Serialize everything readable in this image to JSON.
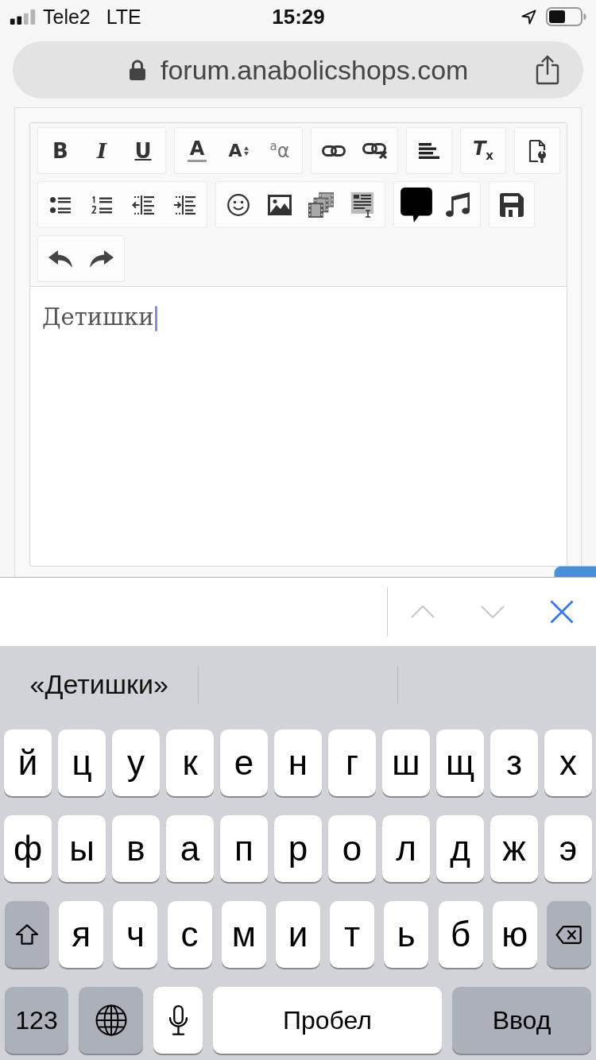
{
  "status_bar": {
    "carrier": "Tele2",
    "network": "LTE",
    "time": "15:29"
  },
  "address_bar": {
    "url": "forum.anabolicshops.com"
  },
  "editor": {
    "toolbar": [
      {
        "buttons": [
          {
            "kind": "bold",
            "label": "B"
          },
          {
            "kind": "italic",
            "label": "I"
          },
          {
            "kind": "underline",
            "label": "U"
          }
        ]
      },
      {
        "buttons": [
          {
            "kind": "color",
            "label": "A"
          },
          {
            "kind": "size",
            "label": "A"
          },
          {
            "kind": "case",
            "label": "$^{a}$α"
          }
        ]
      },
      {
        "buttons": [
          {
            "kind": "link"
          },
          {
            "kind": "unlink"
          }
        ]
      },
      {
        "buttons": [
          {
            "kind": "align"
          }
        ]
      },
      {
        "buttons": [
          {
            "kind": "clear",
            "label": "T$_{x}$"
          }
        ]
      },
      {
        "buttons": [
          {
            "kind": "source"
          }
        ]
      },
      {
        "buttons": [
          {
            "kind": "bullets"
          },
          {
            "kind": "numbers"
          },
          {
            "kind": "outdent"
          },
          {
            "kind": "indent"
          }
        ]
      },
      {
        "buttons": [
          {
            "kind": "smiley"
          },
          {
            "kind": "image"
          },
          {
            "kind": "media"
          },
          {
            "kind": "template"
          }
        ]
      },
      {
        "buttons": [
          {
            "kind": "comment"
          },
          {
            "kind": "audio"
          }
        ]
      },
      {
        "buttons": [
          {
            "kind": "save"
          }
        ]
      },
      {
        "buttons": [
          {
            "kind": "undo"
          },
          {
            "kind": "redo"
          }
        ]
      }
    ],
    "text": "Детишки"
  },
  "accessory_bar": {
    "buttons": [
      {
        "kind": "previous",
        "disabled": true
      },
      {
        "kind": "next",
        "disabled": true
      },
      {
        "kind": "close",
        "disabled": false
      }
    ]
  },
  "keyboard": {
    "suggestions": [
      "«Детишки»"
    ],
    "rows": [
      {
        "keys": [
          {
            "kind": "letter",
            "label": "й"
          },
          {
            "kind": "letter",
            "label": "ц"
          },
          {
            "kind": "letter",
            "label": "у"
          },
          {
            "kind": "letter",
            "label": "к"
          },
          {
            "kind": "letter",
            "label": "е"
          },
          {
            "kind": "letter",
            "label": "н"
          },
          {
            "kind": "letter",
            "label": "г"
          },
          {
            "kind": "letter",
            "label": "ш"
          },
          {
            "kind": "letter",
            "label": "щ"
          },
          {
            "kind": "letter",
            "label": "з"
          },
          {
            "kind": "letter",
            "label": "х"
          }
        ]
      },
      {
        "keys": [
          {
            "kind": "letter",
            "label": "ф"
          },
          {
            "kind": "letter",
            "label": "ы"
          },
          {
            "kind": "letter",
            "label": "в"
          },
          {
            "kind": "letter",
            "label": "а"
          },
          {
            "kind": "letter",
            "label": "п"
          },
          {
            "kind": "letter",
            "label": "р"
          },
          {
            "kind": "letter",
            "label": "о"
          },
          {
            "kind": "letter",
            "label": "л"
          },
          {
            "kind": "letter",
            "label": "д"
          },
          {
            "kind": "letter",
            "label": "ж"
          },
          {
            "kind": "letter",
            "label": "э"
          }
        ]
      },
      {
        "keys": [
          {
            "kind": "shift"
          },
          {
            "kind": "letter",
            "label": "я"
          },
          {
            "kind": "letter",
            "label": "ч"
          },
          {
            "kind": "letter",
            "label": "с"
          },
          {
            "kind": "letter",
            "label": "м"
          },
          {
            "kind": "letter",
            "label": "и"
          },
          {
            "kind": "letter",
            "label": "т"
          },
          {
            "kind": "letter",
            "label": "ь"
          },
          {
            "kind": "letter",
            "label": "б"
          },
          {
            "kind": "letter",
            "label": "ю"
          },
          {
            "kind": "delete"
          }
        ]
      },
      {
        "keys": [
          {
            "kind": "mode",
            "label": "123"
          },
          {
            "kind": "globe"
          },
          {
            "kind": "mic"
          },
          {
            "kind": "space",
            "label": "Пробел"
          },
          {
            "kind": "return",
            "label": "Ввод"
          }
        ]
      }
    ]
  }
}
